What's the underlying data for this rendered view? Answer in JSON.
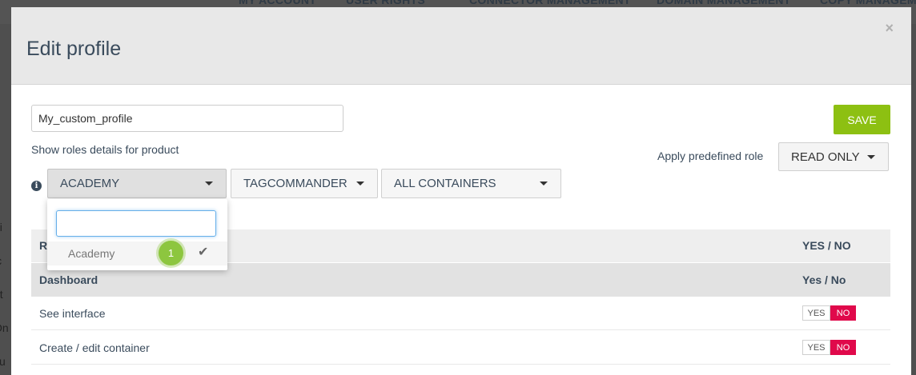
{
  "topnav": {
    "items": [
      "MY ACCOUNT",
      "USER RIGHTS",
      "CONNECTOR MANAGEMENT",
      "DOMAIN MANAGEMENT",
      "COPY MANAGEM"
    ]
  },
  "background_fragments": [
    "ni",
    "ic",
    "et",
    "On",
    "cu"
  ],
  "modal": {
    "title": "Edit profile",
    "close_label": "×",
    "profile_name_value": "My_custom_profile",
    "save_label": "SAVE",
    "roles_label": "Show roles details for product",
    "apply_label": "Apply predefined role",
    "predefined_role": "READ ONLY",
    "info_icon": "i",
    "selectors": {
      "product": "ACADEMY",
      "site": "TAGCOMMANDER",
      "container": "ALL CONTAINERS"
    },
    "dropdown": {
      "search_value": "",
      "options": [
        {
          "label": "Academy",
          "selected": true,
          "check": "✔"
        }
      ]
    },
    "badge": "1",
    "table": {
      "header": {
        "left": "R",
        "right": "YES / NO"
      },
      "rows": [
        {
          "type": "section",
          "label": "Dashboard",
          "value": "Yes / No"
        },
        {
          "type": "permission",
          "label": "See interface",
          "yes": "YES",
          "no": "NO",
          "state": "NO"
        },
        {
          "type": "permission",
          "label": "Create / edit container",
          "yes": "YES",
          "no": "NO",
          "state": "NO"
        }
      ]
    }
  },
  "colors": {
    "save": "#8dc012",
    "no_active": "#e0094b",
    "title": "#3a4b5c",
    "badge": "#8dc63f"
  }
}
